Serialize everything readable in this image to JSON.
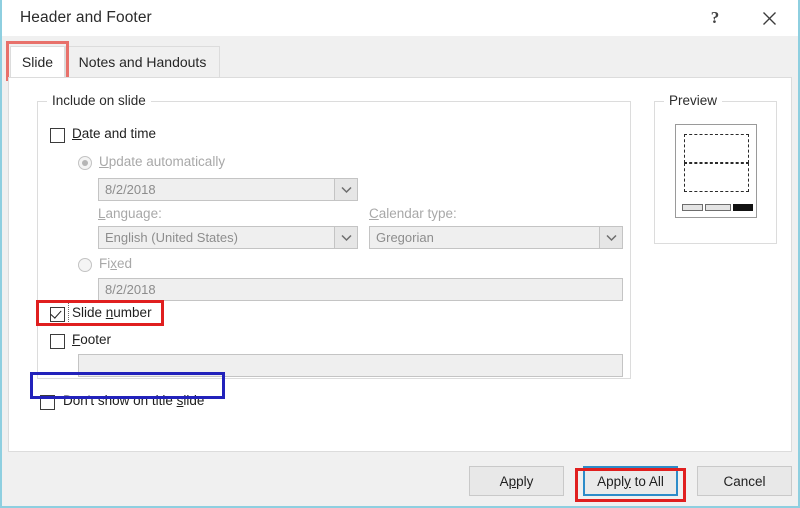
{
  "window": {
    "title": "Header and Footer",
    "help_icon": "question-mark-icon",
    "close_icon": "close-x-icon"
  },
  "tabs": [
    {
      "id": "slide",
      "label": "Slide",
      "active": true
    },
    {
      "id": "notes-and-handouts",
      "label": "Notes and Handouts",
      "active": false
    }
  ],
  "groups": {
    "include_on_slide": {
      "label": "Include on slide"
    },
    "preview": {
      "label": "Preview"
    }
  },
  "include_on_slide": {
    "date_and_time": {
      "label": "Date and time",
      "accel": "D",
      "checked": false,
      "enabled": true
    },
    "update_automatically": {
      "label": "Update automatically",
      "accel": "U",
      "selected": true,
      "enabled": false
    },
    "date_combo": {
      "value": "8/2/2018",
      "enabled": false,
      "arrow_icon": "chevron-down-icon"
    },
    "language": {
      "label": "Language:",
      "accel": "L",
      "value": "English (United States)",
      "enabled": false,
      "arrow_icon": "chevron-down-icon"
    },
    "calendar_type": {
      "label": "Calendar type:",
      "accel": "C",
      "value": "Gregorian",
      "enabled": false,
      "arrow_icon": "chevron-down-icon"
    },
    "fixed": {
      "label": "Fixed",
      "accel": "x",
      "selected": false,
      "enabled": false
    },
    "fixed_field": {
      "value": "8/2/2018",
      "enabled": false
    },
    "slide_number": {
      "label_pre": "Slide ",
      "label_accel": "n",
      "label_post": "umber",
      "label": "Slide number",
      "checked": true,
      "enabled": true,
      "focused": true
    },
    "footer": {
      "label": "Footer",
      "accel": "F",
      "checked": false,
      "enabled": true
    },
    "footer_field": {
      "value": "",
      "placeholder": "",
      "enabled": false
    }
  },
  "dont_show_on_title_slide": {
    "label_pre": "Don't show on title ",
    "label_accel": "s",
    "label_post": "lide",
    "label": "Don't show on title slide",
    "checked": false,
    "enabled": true
  },
  "preview": {
    "slide_thumbnail": {
      "title_placeholder": "dashed-placeholder",
      "body_placeholder": "dashed-placeholder",
      "footer_bars": [
        {
          "name": "date-bar",
          "state": "empty"
        },
        {
          "name": "footer-bar",
          "state": "empty"
        },
        {
          "name": "slide-number-bar",
          "state": "filled"
        }
      ]
    }
  },
  "buttons": [
    {
      "id": "apply",
      "label_pre": "A",
      "label_accel": "p",
      "label_post": "ply",
      "label": "Apply",
      "default": false
    },
    {
      "id": "apply-to-all",
      "label_pre": "Appl",
      "label_accel": "y",
      "label_post": " to All",
      "label": "Apply to All",
      "default": true
    },
    {
      "id": "cancel",
      "label_pre": "Cancel",
      "label_accel": "",
      "label_post": "",
      "label": "Cancel",
      "default": false
    }
  ],
  "annotations": [
    {
      "name": "slide-tab-highlight",
      "color": "#e8716b",
      "target": "tab-slide"
    },
    {
      "name": "slide-number-highlight",
      "color": "#e01f1f",
      "target": "slide-number-checkbox"
    },
    {
      "name": "dont-show-on-title-slide-highlight",
      "color": "#2222bb",
      "target": "dont-show-on-title-slide-checkbox"
    },
    {
      "name": "apply-to-all-highlight",
      "color": "#e01f1f",
      "target": "apply-to-all-button"
    }
  ],
  "colors": {
    "dialog_border": "#8ecfe0",
    "annotation_red": "#e01f1f",
    "annotation_pink": "#e8716b",
    "annotation_blue": "#2222bb",
    "default_button_border": "#2d8cc9",
    "panel_background": "#f0f0f0",
    "content_background": "#ffffff"
  }
}
